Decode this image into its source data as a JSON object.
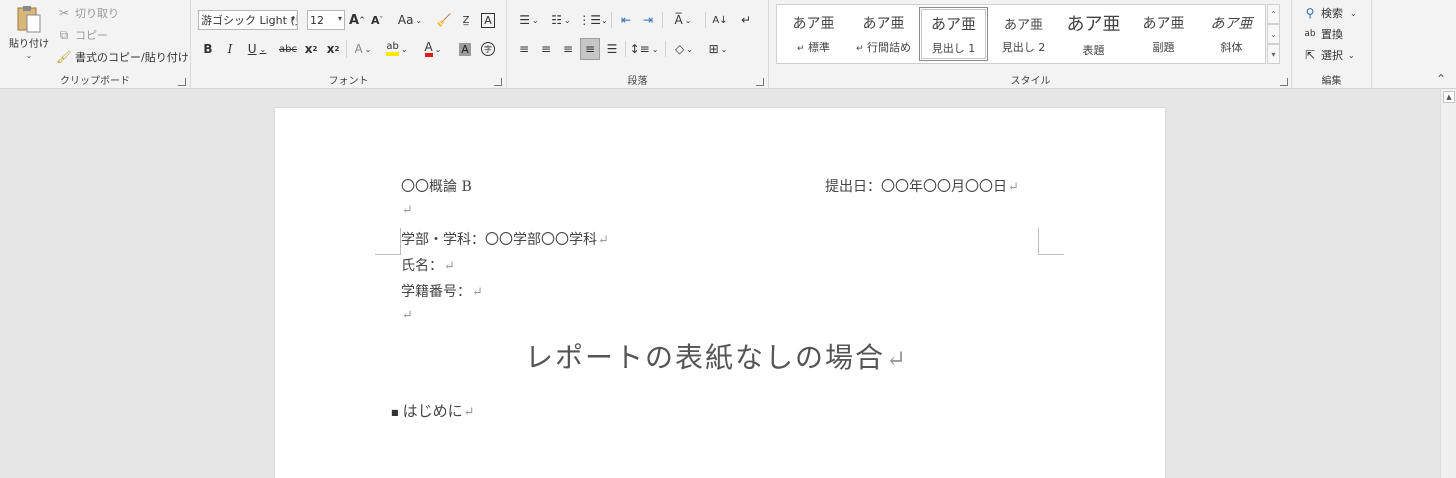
{
  "ribbon": {
    "clipboard": {
      "paste": "貼り付け",
      "cut": "切り取り",
      "copy": "コピー",
      "format_painter": "書式のコピー/貼り付け",
      "group_label": "クリップボード"
    },
    "font": {
      "font_name": "游ゴシック Light (見",
      "font_size": "12",
      "grow": "A",
      "shrink": "A",
      "change_case": "Aa",
      "bold": "B",
      "italic": "I",
      "underline": "U",
      "strikethrough": "abc",
      "subscript": "x",
      "superscript": "x",
      "group_label": "フォント"
    },
    "paragraph": {
      "group_label": "段落"
    },
    "styles": {
      "items": [
        {
          "preview": "あア亜",
          "name": "標準",
          "prefix": "↵"
        },
        {
          "preview": "あア亜",
          "name": "行間詰め",
          "prefix": "↵"
        },
        {
          "preview": "あア亜",
          "name": "見出し 1",
          "prefix": ""
        },
        {
          "preview": "あア亜",
          "name": "見出し 2",
          "prefix": ""
        },
        {
          "preview": "あア亜",
          "name": "表題",
          "prefix": ""
        },
        {
          "preview": "あア亜",
          "name": "副題",
          "prefix": ""
        },
        {
          "preview": "あア亜",
          "name": "斜体",
          "prefix": ""
        }
      ],
      "group_label": "スタイル"
    },
    "editing": {
      "find": "検索",
      "replace": "置換",
      "select": "選択",
      "group_label": "編集"
    }
  },
  "document": {
    "course": "〇〇概論 B",
    "submit_date": "提出日：〇〇年〇〇月〇〇日",
    "department": "学部・学科：〇〇学部〇〇学科",
    "name": "氏名：",
    "student_id": "学籍番号：",
    "title": "レポートの表紙なしの場合",
    "heading": "はじめに",
    "paragraph_mark": "↵"
  }
}
